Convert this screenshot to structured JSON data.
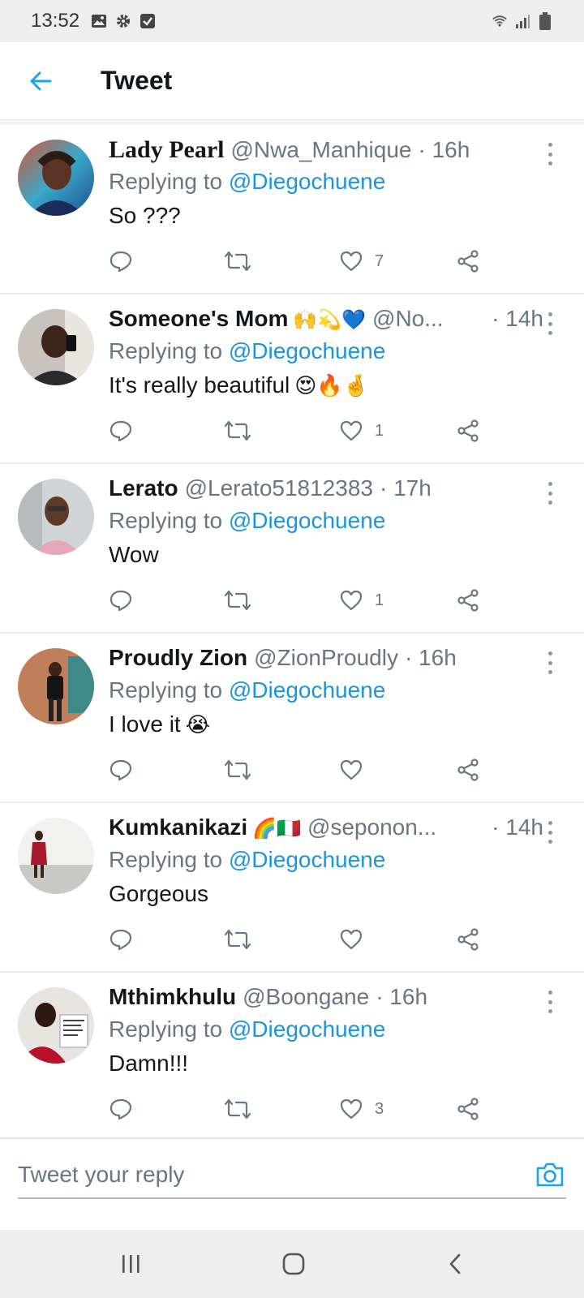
{
  "status_bar": {
    "time": "13:52"
  },
  "header": {
    "title": "Tweet"
  },
  "colors": {
    "link": "#1b95e0",
    "secondary": "#657786",
    "text": "#14171a"
  },
  "tweets": [
    {
      "name": "Lady Pearl",
      "name_emoji": "",
      "handle": "@Nwa_Manhique",
      "time": "· 16h",
      "replying_prefix": "Replying to ",
      "replying_to": "@Diegochuene",
      "text": "So ???",
      "text_emoji": "",
      "likes": "7"
    },
    {
      "name": "Someone's Mom",
      "name_emoji": "🙌💫💙",
      "handle": "@No...",
      "time": "· 14h",
      "replying_prefix": "Replying to ",
      "replying_to": "@Diegochuene",
      "text": "It's really beautiful",
      "text_emoji": "😍🔥🤞",
      "likes": "1"
    },
    {
      "name": "Lerato",
      "name_emoji": "",
      "handle": "@Lerato51812383",
      "time": "· 17h",
      "replying_prefix": "Replying to ",
      "replying_to": "@Diegochuene",
      "text": "Wow",
      "text_emoji": "",
      "likes": "1"
    },
    {
      "name": "Proudly Zion",
      "name_emoji": "",
      "handle": "@ZionProudly",
      "time": "· 16h",
      "replying_prefix": "Replying to ",
      "replying_to": "@Diegochuene",
      "text": "I love it",
      "text_emoji": "😭",
      "likes": ""
    },
    {
      "name": "Kumkanikazi",
      "name_emoji": "🌈🇮🇹",
      "handle": "@seponon...",
      "time": "· 14h",
      "replying_prefix": "Replying to ",
      "replying_to": "@Diegochuene",
      "text": "Gorgeous",
      "text_emoji": "",
      "likes": ""
    },
    {
      "name": "Mthimkhulu",
      "name_emoji": "",
      "handle": "@Boongane",
      "time": "· 16h",
      "replying_prefix": "Replying to ",
      "replying_to": "@Diegochuene",
      "text": "Damn!!!",
      "text_emoji": "",
      "likes": "3"
    }
  ],
  "reply_bar": {
    "placeholder": "Tweet your reply"
  }
}
